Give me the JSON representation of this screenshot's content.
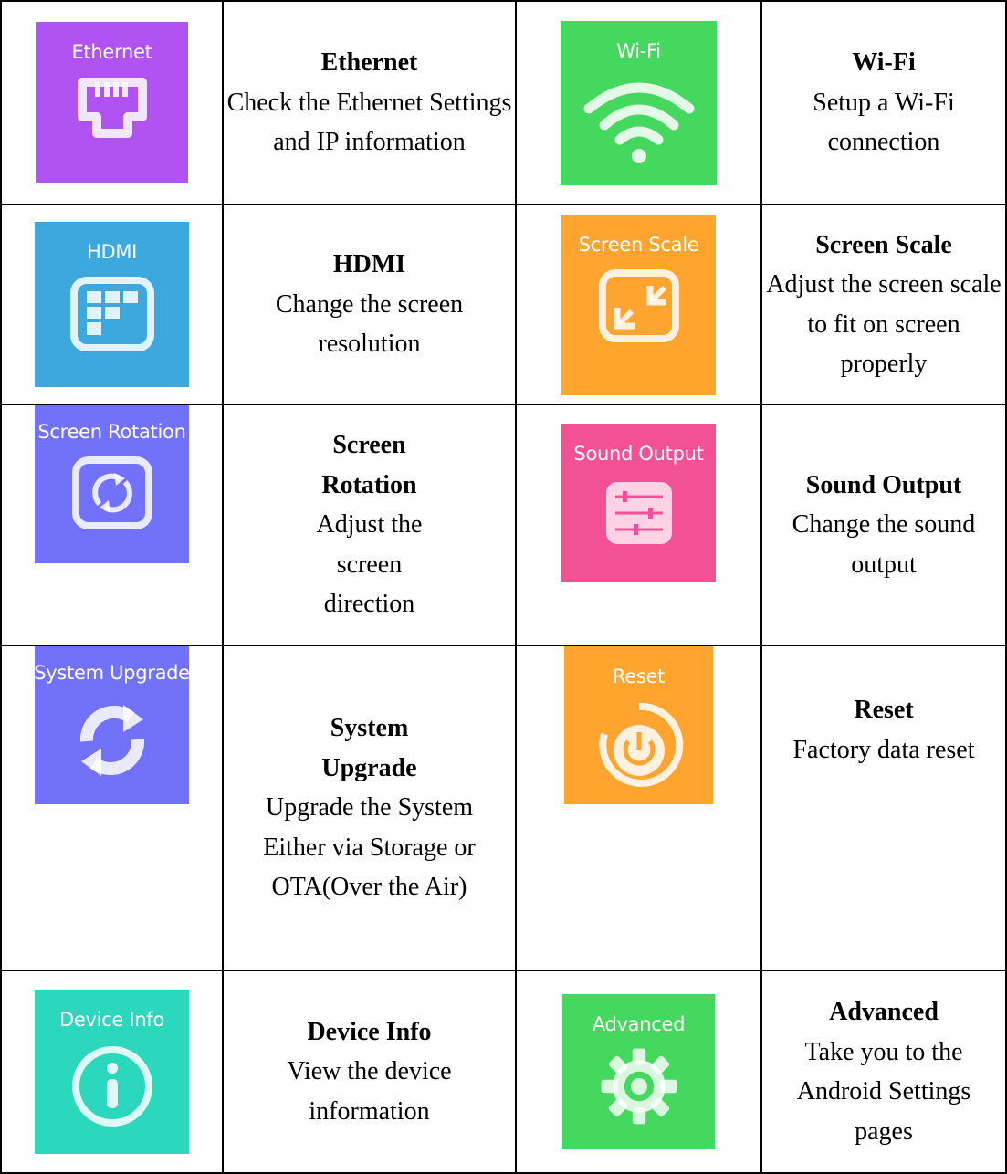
{
  "items": [
    {
      "tile_label": "Ethernet",
      "title": "Ethernet",
      "desc": "Check the Ethernet Settings and IP information",
      "color": "#B152F2",
      "icon": "ethernet-icon"
    },
    {
      "tile_label": "Wi-Fi",
      "title": "Wi-Fi",
      "desc": "Setup a Wi-Fi connection",
      "color": "#45D85E",
      "icon": "wifi-icon"
    },
    {
      "tile_label": "HDMI",
      "title": "HDMI",
      "desc": "Change the screen resolution",
      "color": "#3CA8DD",
      "icon": "hdmi-icon"
    },
    {
      "tile_label": "Screen Scale",
      "title": "Screen Scale",
      "desc": "Adjust the screen scale to fit on screen properly",
      "color": "#FFA42F",
      "icon": "screen-scale-icon"
    },
    {
      "tile_label": "Screen Rotation",
      "title": "Screen Rotation",
      "desc": "Adjust the screen direction",
      "color": "#7271F9",
      "icon": "screen-rotation-icon"
    },
    {
      "tile_label": "Sound Output",
      "title": "Sound Output",
      "desc": "Change the sound output",
      "color": "#F25196",
      "icon": "sound-output-icon"
    },
    {
      "tile_label": "System Upgrade",
      "title": "System Upgrade",
      "desc": "Upgrade the System Either via Storage or OTA(Over the Air)",
      "color": "#7271F9",
      "icon": "system-upgrade-icon"
    },
    {
      "tile_label": "Reset",
      "title": "Reset",
      "desc": "Factory data reset",
      "color": "#FFA42F",
      "icon": "reset-icon"
    },
    {
      "tile_label": "Device Info",
      "title": "Device Info",
      "desc": "View the device information",
      "color": "#2BD8BE",
      "icon": "device-info-icon"
    },
    {
      "tile_label": "Advanced",
      "title": "Advanced",
      "desc": "Take you to the Android Settings pages",
      "color": "#45D85E",
      "icon": "gear-icon"
    }
  ]
}
